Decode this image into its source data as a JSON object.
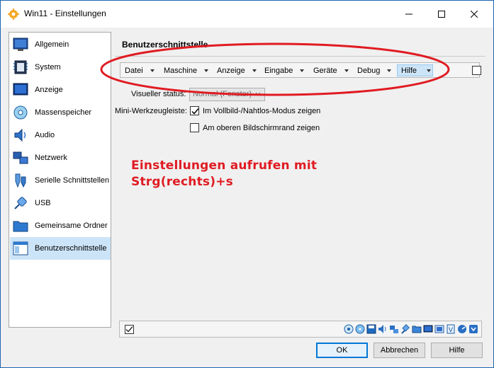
{
  "window": {
    "title": "Win11 - Einstellungen",
    "controls": {
      "minimize": "—",
      "maximize": "☐",
      "close": "✕"
    }
  },
  "sidebar": {
    "items": [
      {
        "label": "Allgemein",
        "icon": "general-icon"
      },
      {
        "label": "System",
        "icon": "system-icon"
      },
      {
        "label": "Anzeige",
        "icon": "display-icon"
      },
      {
        "label": "Massenspeicher",
        "icon": "storage-icon"
      },
      {
        "label": "Audio",
        "icon": "audio-icon"
      },
      {
        "label": "Netzwerk",
        "icon": "network-icon"
      },
      {
        "label": "Serielle Schnittstellen",
        "icon": "serial-ports-icon"
      },
      {
        "label": "USB",
        "icon": "usb-icon"
      },
      {
        "label": "Gemeinsame Ordner",
        "icon": "shared-folders-icon"
      },
      {
        "label": "Benutzerschnittstelle",
        "icon": "user-interface-icon",
        "selected": true
      }
    ]
  },
  "page": {
    "title": "Benutzerschnittstelle",
    "menubar": {
      "items": [
        "Datei",
        "Maschine",
        "Anzeige",
        "Eingabe",
        "Geräte",
        "Debug",
        "Hilfe"
      ],
      "highlighted": "Hilfe",
      "enabled_checked": false
    },
    "visual_status": {
      "label": "Visueller status:",
      "value": "Normal (Fenster)"
    },
    "mini_toolbar": {
      "label": "Mini-Werkzeugleiste:",
      "option1": {
        "label": "Im Vollbild-/Nahtlos-Modus zeigen",
        "checked": true
      },
      "option2": {
        "label": "Am oberen Bildschirmrand zeigen",
        "checked": false
      }
    },
    "hint": {
      "line1": "Einstellungen aufrufen mit",
      "line2": "Strg(rechts)+s",
      "color": "#e01b22"
    },
    "statusbar": {
      "enabled_checked": true,
      "icons": [
        "hard-disk-icon",
        "optical-drive-icon",
        "floppy-icon",
        "audio-icon",
        "network-icon",
        "usb-icon",
        "shared-folder-icon",
        "display-icon",
        "recording-icon",
        "guest-additions-icon",
        "cpu-icon",
        "mouse-integration-icon",
        "keyboard-icon"
      ]
    }
  },
  "buttons": {
    "ok": "OK",
    "cancel": "Abbrechen",
    "help": "Hilfe"
  },
  "colors": {
    "accent": "#0078d7",
    "selection": "#cce4f7",
    "annotation_red": "#e01b22"
  }
}
